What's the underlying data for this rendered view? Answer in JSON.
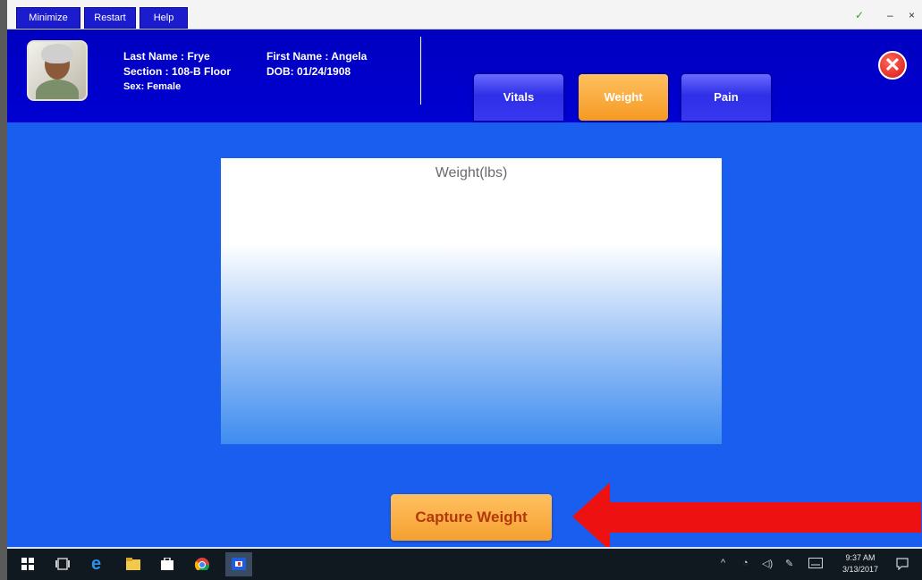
{
  "toolbar": {
    "minimize_label": "Minimize",
    "restart_label": "Restart",
    "help_label": "Help",
    "window_check": "✓",
    "window_min": "–",
    "window_close": "×"
  },
  "patient": {
    "last_name": "Last Name : Frye",
    "section": "Section : 108-B Floor",
    "sex": "Sex: Female",
    "first_name": "First Name : Angela",
    "dob": "DOB: 01/24/1908"
  },
  "tabs": [
    {
      "label": "Vitals",
      "active": false
    },
    {
      "label": "Weight",
      "active": true
    },
    {
      "label": "Pain",
      "active": false
    }
  ],
  "main": {
    "panel_title": "Weight(lbs)",
    "capture_label": "Capture Weight"
  },
  "taskbar": {
    "time": "9:37 AM",
    "date": "3/13/2017"
  },
  "colors": {
    "header": "#0000c8",
    "background": "#1a5ef0",
    "accent_orange": "#f59a23",
    "arrow": "#ee1111"
  }
}
